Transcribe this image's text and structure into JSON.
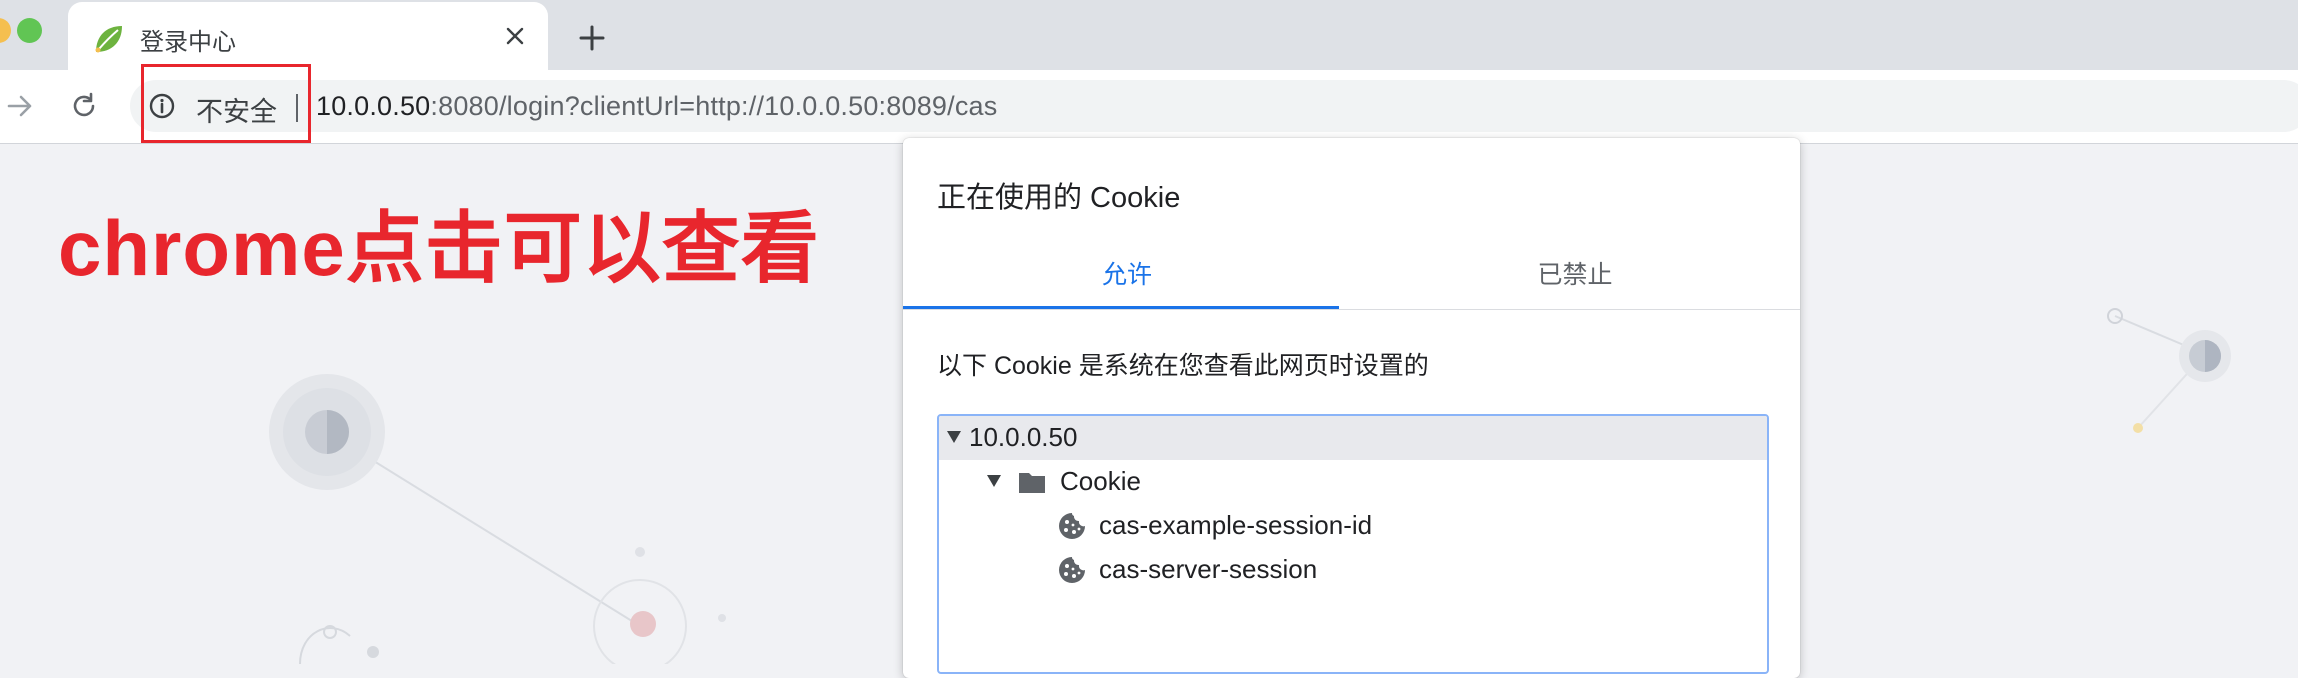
{
  "browser": {
    "tab": {
      "title": "登录中心",
      "favicon": "leaf-icon",
      "close_icon": "close-icon"
    },
    "new_tab_icon": "plus-icon",
    "toolbar": {
      "forward_icon": "arrow-forward-icon",
      "reload_icon": "reload-icon"
    },
    "omnibox": {
      "security_icon": "info-icon",
      "security_label": "不安全",
      "url_host": "10.0.0.50",
      "url_rest": ":8080/login?clientUrl=http://10.0.0.50:8089/cas"
    }
  },
  "annotation": {
    "text": "chrome点击可以查看",
    "color": "#e8262d"
  },
  "cookie_popup": {
    "title": "正在使用的 Cookie",
    "tabs": [
      {
        "label": "允许",
        "active": true
      },
      {
        "label": "已禁止",
        "active": false
      }
    ],
    "description": "以下 Cookie 是系统在您查看此网页时设置的",
    "tree": {
      "site": "10.0.0.50",
      "folder": "Cookie",
      "cookies": [
        "cas-example-session-id",
        "cas-server-session"
      ]
    }
  },
  "colors": {
    "accent": "#1a73e8",
    "highlight_red": "#e8262d",
    "leaf_green": "#6db33f"
  }
}
